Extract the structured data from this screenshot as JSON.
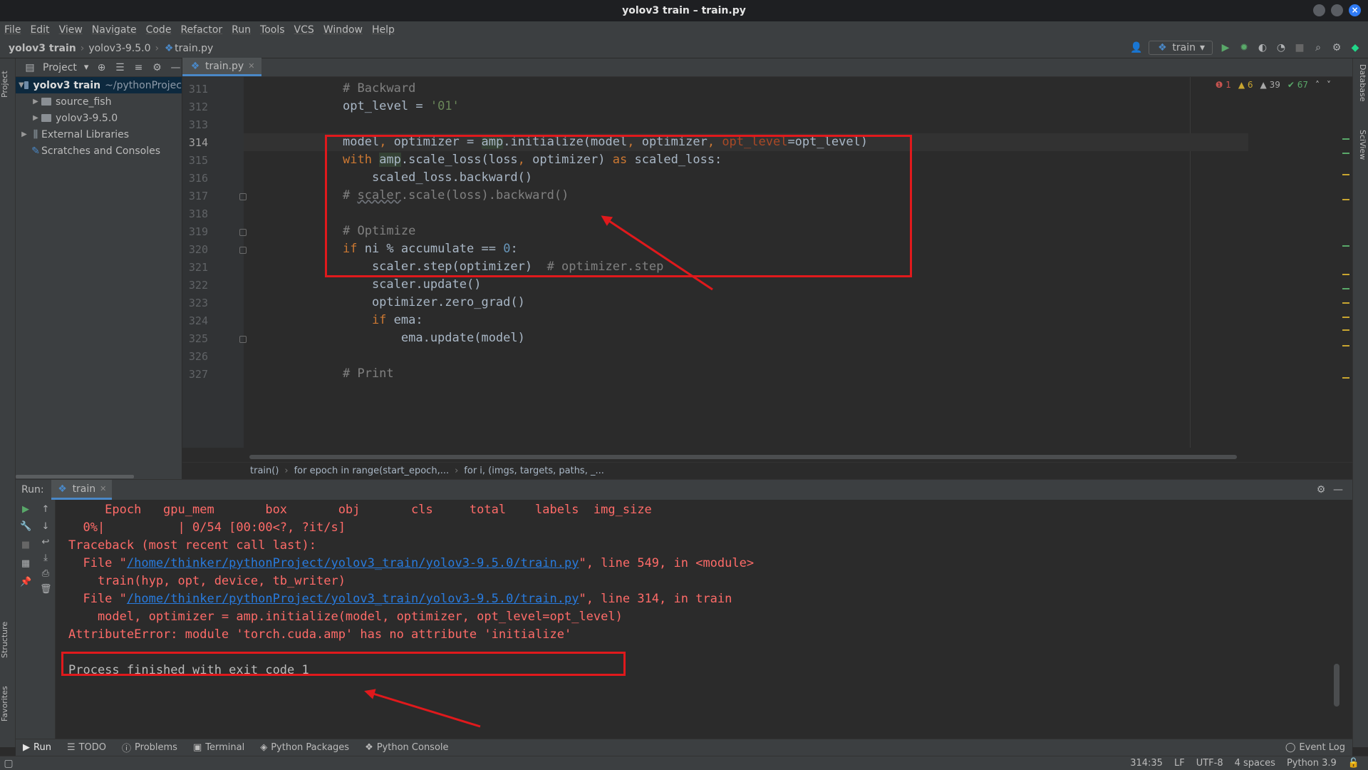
{
  "window": {
    "title": "yolov3 train – train.py"
  },
  "menu": [
    "File",
    "Edit",
    "View",
    "Navigate",
    "Code",
    "Refactor",
    "Run",
    "Tools",
    "VCS",
    "Window",
    "Help"
  ],
  "navbar": {
    "crumbs": [
      "yolov3 train",
      "yolov3-9.5.0",
      "train.py"
    ],
    "run_config": "train"
  },
  "project": {
    "header": "Project",
    "tree": [
      {
        "label": "yolov3 train",
        "path": "~/pythonProjec"
      },
      {
        "label": "source_fish"
      },
      {
        "label": "yolov3-9.5.0"
      },
      {
        "label": "External Libraries"
      },
      {
        "label": "Scratches and Consoles"
      }
    ]
  },
  "side_tabs": {
    "left_top": "Project",
    "left_structure": "Structure",
    "left_favorites": "Favorites",
    "right_database": "Database",
    "right_sciview": "SciView"
  },
  "editor": {
    "tab": "train.py",
    "inspections": {
      "errors": "1",
      "warnings": "6",
      "weak_warnings": "39",
      "ok": "67"
    },
    "line_numbers": [
      "311",
      "312",
      "313",
      "314",
      "315",
      "316",
      "317",
      "318",
      "319",
      "320",
      "321",
      "322",
      "323",
      "324",
      "325",
      "326",
      "327"
    ],
    "lines": {
      "l311": "# Backward",
      "l312a": "opt_level = ",
      "l312b": "'01'",
      "l314a": "model",
      "l314b": ", ",
      "l314c": "optimizer = ",
      "l314d": "amp",
      "l314e": ".initialize(model",
      "l314f": ", ",
      "l314g": "optimizer",
      "l314h": ", ",
      "l314i": "opt_level",
      "l314j": "=opt_level)",
      "l315a": "with ",
      "l315b": "amp",
      "l315c": ".scale_loss(loss",
      "l315d": ", ",
      "l315e": "optimizer) ",
      "l315f": "as ",
      "l315g": "scaled_loss:",
      "l316": "    scaled_loss.backward()",
      "l317a": "# ",
      "l317b": "scaler",
      "l317c": ".scale(loss).backward()",
      "l319": "# Optimize",
      "l320a": "if ",
      "l320b": "ni % accumulate == ",
      "l320c": "0",
      "l320d": ":",
      "l321a": "    scaler.step(optimizer)  ",
      "l321b": "# optimizer.step",
      "l322": "    scaler.update()",
      "l323": "    optimizer.zero_grad()",
      "l324a": "    if ",
      "l324b": "ema:",
      "l325": "        ema.update(model)",
      "l327": "# Print"
    },
    "breadcrumbs": [
      "train()",
      "for epoch in range(start_epoch,...",
      "for i, (imgs, targets, paths, _..."
    ]
  },
  "run": {
    "label": "Run:",
    "tab": "train",
    "console": {
      "header": "     Epoch   gpu_mem       box       obj       cls     total    labels  img_size",
      "progress": "  0%|          | 0/54 [00:00<?, ?it/s]",
      "traceback": "Traceback (most recent call last):",
      "file1_pre": "  File \"",
      "file1_link": "/home/thinker/pythonProject/yolov3_train/yolov3-9.5.0/train.py",
      "file1_post": "\", line 549, in <module>",
      "code1": "    train(hyp, opt, device, tb_writer)",
      "file2_pre": "  File \"",
      "file2_link": "/home/thinker/pythonProject/yolov3_train/yolov3-9.5.0/train.py",
      "file2_post": "\", line 314, in train",
      "code2": "    model, optimizer = amp.initialize(model, optimizer, opt_level=opt_level)",
      "error": "AttributeError: module 'torch.cuda.amp' has no attribute 'initialize'",
      "exit": "Process finished with exit code 1"
    }
  },
  "bottom_tools": [
    "Run",
    "TODO",
    "Problems",
    "Terminal",
    "Python Packages",
    "Python Console"
  ],
  "event_log": "Event Log",
  "status": {
    "position": "314:35",
    "line_sep": "LF",
    "encoding": "UTF-8",
    "indent": "4 spaces",
    "interpreter": "Python 3.9"
  },
  "colors": {
    "annotation_red": "#e0191c",
    "accent_blue": "#4a88c7",
    "error_text": "#ff6b68",
    "link": "#287bde"
  }
}
